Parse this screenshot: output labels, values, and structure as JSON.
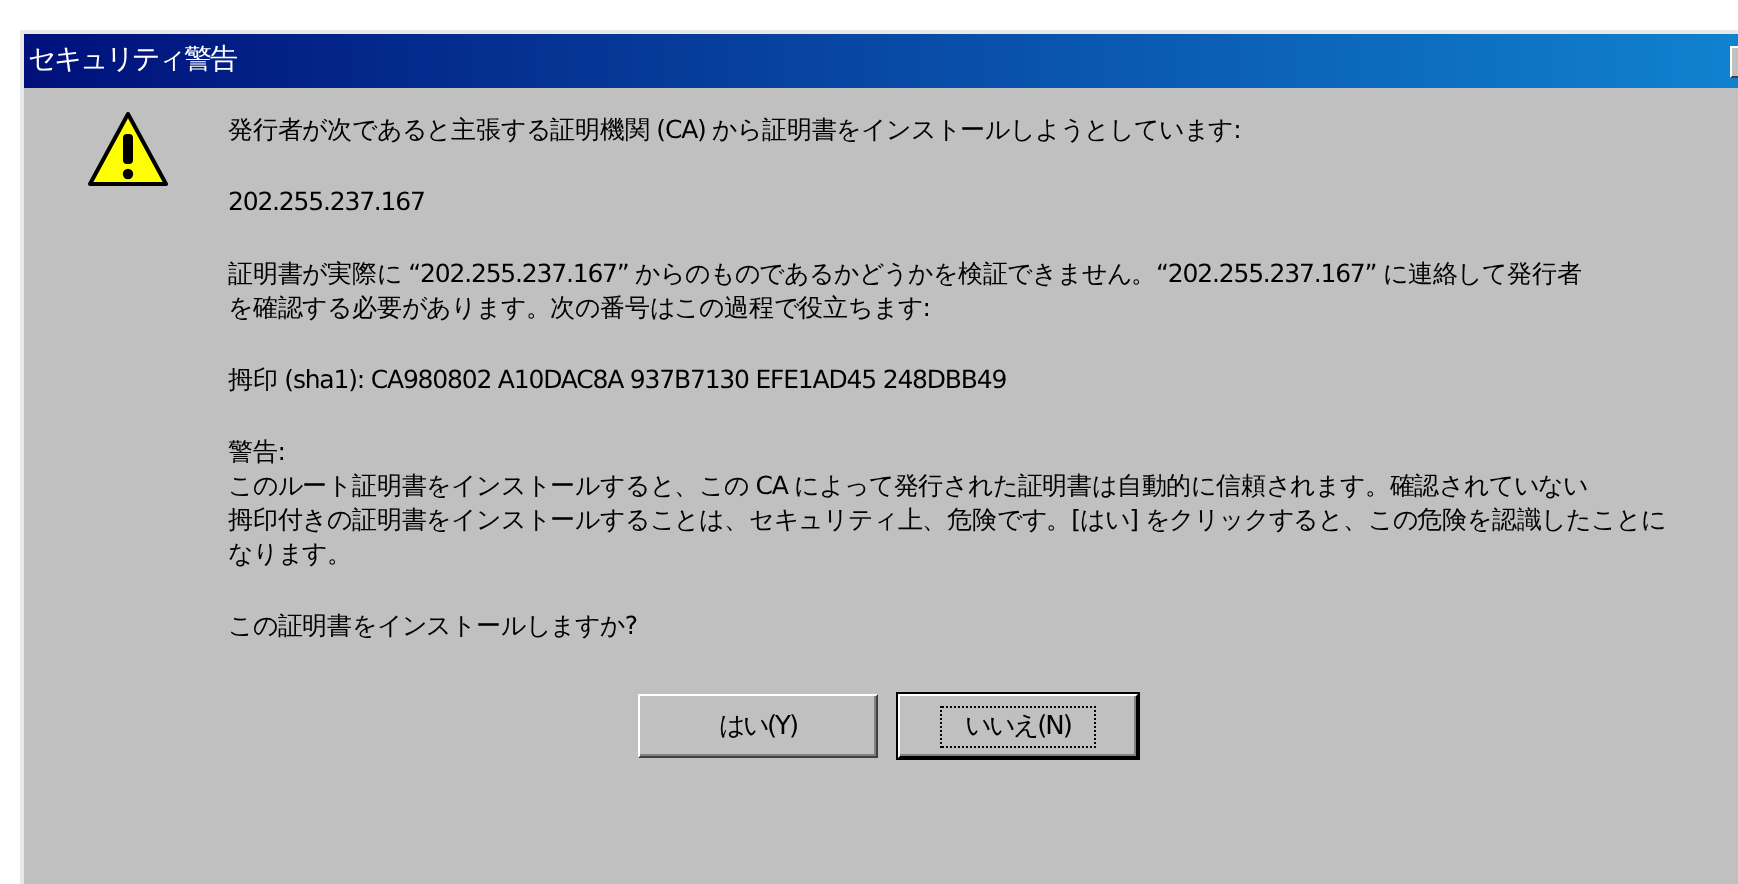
{
  "window": {
    "title": "セキュリティ警告"
  },
  "paragraphs": [
    {
      "lines": [
        "発行者が次であると主張する証明機関 (CA) から証明書をインストールしようとしています:"
      ]
    },
    {
      "lines": [
        "202.255.237.167"
      ]
    },
    {
      "lines": [
        "証明書が実際に “202.255.237.167” からのものであるかどうかを検証できません。“202.255.237.167” に連絡して発行者",
        "を確認する必要があります。次の番号はこの過程で役立ちます:"
      ]
    },
    {
      "lines": [
        "拇印 (sha1): CA980802 A10DAC8A 937B7130 EFE1AD45 248DBB49"
      ]
    },
    {
      "lines": [
        "警告:",
        "このルート証明書をインストールすると、この CA によって発行された証明書は自動的に信頼されます。確認されていない",
        "拇印付きの証明書をインストールすることは、セキュリティ上、危険です。[はい] をクリックすると、この危険を認識したことに",
        "なります。"
      ]
    },
    {
      "lines": [
        "この証明書をインストールしますか?"
      ]
    }
  ],
  "buttons": [
    {
      "label": "はい(Y)",
      "focused": false
    },
    {
      "label": "いいえ(N)",
      "focused": true
    }
  ]
}
